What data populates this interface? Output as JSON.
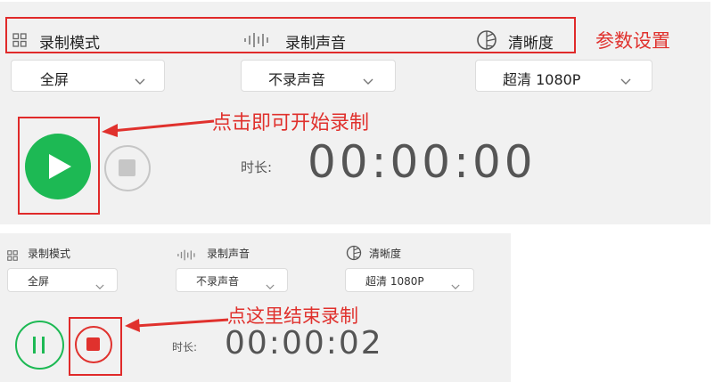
{
  "recorder_before": {
    "mode": {
      "icon": "grid-icon",
      "label": "录制模式",
      "value": "全屏"
    },
    "audio": {
      "icon": "sound-wave-icon",
      "label": "录制声音",
      "value": "不录声音"
    },
    "quality": {
      "icon": "quality-dial-icon",
      "label": "清晰度",
      "value": "超清 1080P"
    },
    "start_button": {
      "icon": "play-icon",
      "color": "#1db954"
    },
    "stop_button": {
      "icon": "stop-icon",
      "state": "disabled",
      "color": "#bdbdbd"
    },
    "duration_label": "时长:",
    "duration_value": "00:00:00"
  },
  "recorder_after": {
    "mode": {
      "icon": "grid-icon",
      "label": "录制模式",
      "value": "全屏"
    },
    "audio": {
      "icon": "sound-wave-icon",
      "label": "录制声音",
      "value": "不录声音"
    },
    "quality": {
      "icon": "quality-dial-icon",
      "label": "清晰度",
      "value": "超清 1080P"
    },
    "pause_button": {
      "icon": "pause-icon",
      "color": "#1db954"
    },
    "stop_button": {
      "icon": "stop-icon",
      "color": "#e0312d"
    },
    "duration_label": "时长:",
    "duration_value": "00:00:02"
  },
  "annotations": {
    "params": "参数设置",
    "start": "点击即可开始录制",
    "end": "点这里结束录制",
    "color": "#e0312d"
  }
}
